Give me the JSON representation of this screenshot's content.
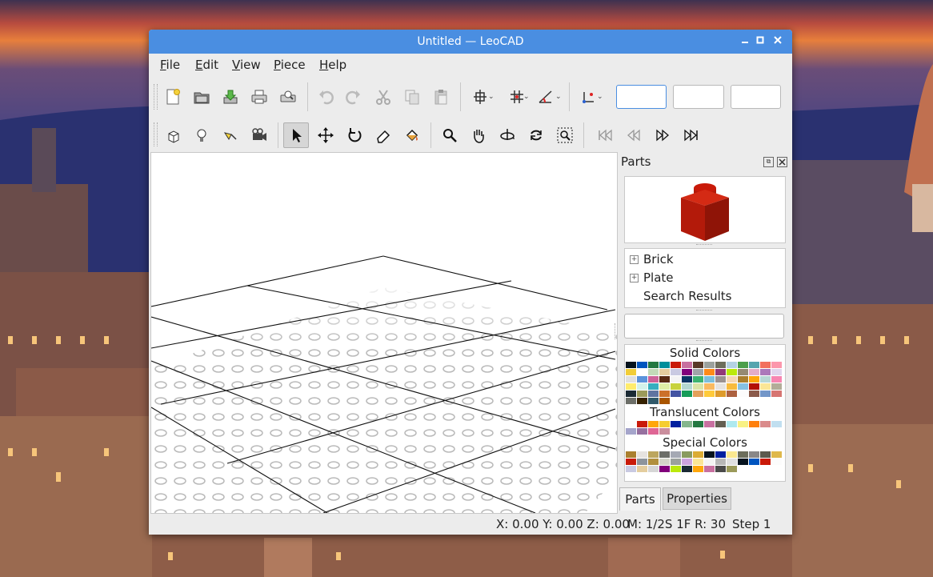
{
  "window": {
    "title": "Untitled — LeoCAD"
  },
  "menubar": {
    "items": [
      {
        "label": "File",
        "accel": "F",
        "rest": "ile"
      },
      {
        "label": "Edit",
        "accel": "E",
        "rest": "dit"
      },
      {
        "label": "View",
        "accel": "V",
        "rest": "iew"
      },
      {
        "label": "Piece",
        "accel": "P",
        "rest": "iece"
      },
      {
        "label": "Help",
        "accel": "H",
        "rest": "elp"
      }
    ]
  },
  "toolbar_top": {
    "icons": [
      "new-file-icon",
      "open-file-icon",
      "save-file-icon",
      "print-icon",
      "print-preview-icon",
      "undo-icon",
      "redo-icon",
      "cut-icon",
      "copy-icon",
      "paste-icon",
      "snap-move-icon",
      "snap-grid-icon",
      "snap-angle-icon",
      "transform-icon"
    ],
    "fields": [
      "",
      "",
      ""
    ]
  },
  "toolbar_tools": {
    "icons": [
      "insert-piece-icon",
      "light-icon",
      "spotlight-icon",
      "camera-icon",
      "select-arrow-icon",
      "move-icon",
      "rotate-icon",
      "eraser-icon",
      "paint-icon",
      "zoom-icon",
      "pan-hand-icon",
      "orbit-icon",
      "roll-icon",
      "zoom-region-icon",
      "first-step-icon",
      "previous-step-icon",
      "next-step-icon",
      "last-step-icon"
    ]
  },
  "parts": {
    "title": "Parts",
    "tree": [
      {
        "label": "Brick",
        "expandable": true
      },
      {
        "label": "Plate",
        "expandable": true
      },
      {
        "label": "Search Results",
        "expandable": false
      }
    ],
    "search_value": "",
    "preview_color": "#c91a09"
  },
  "colors": {
    "solid_label": "Solid Colors",
    "solid": [
      "#05131d",
      "#0055bf",
      "#237841",
      "#008f9b",
      "#c91a09",
      "#c870a0",
      "#583927",
      "#9ba19d",
      "#6d6e5c",
      "#b4d2e3",
      "#4b9f4a",
      "#55a5af",
      "#f2705e",
      "#fc97ac",
      "#f2cd37",
      "#fff",
      "#c2dab8",
      "#e4cd9e",
      "#c9cae2",
      "#81007b",
      "#a0a5a9",
      "#fe8a18",
      "#923978",
      "#bbe90b",
      "#958a73",
      "#e4adc8",
      "#ac78ba",
      "#e1d5ed",
      "#e0e0e0",
      "#5a93db",
      "#cd6298",
      "#582a12",
      "#f4f4f4",
      "#0a3463",
      "#3cb371",
      "#7dbfdd",
      "#9c9291",
      "#f6d7b3",
      "#aa7f2e",
      "#ffa70b",
      "#b7d7d5",
      "#f785b1",
      "#ffec6c",
      "#d3f2ea",
      "#36aebf",
      "#dfeea5",
      "#c7d23c",
      "#b3d7d1",
      "#d9e4a7",
      "#f9ba61",
      "#e6e3e0",
      "#f8bb3d",
      "#86c1e1",
      "#b31004",
      "#fbe696",
      "#b3ac98",
      "#1b2a34",
      "#9b9a5a",
      "#6074a1",
      "#cc702a",
      "#4354a3",
      "#169c59",
      "#e3a05b",
      "#ffca3a",
      "#de9b2b",
      "#ad6140",
      "#fcfcfc",
      "#8b5a4a",
      "#7396c8",
      "#d67572",
      "#6c6e68",
      "#352100",
      "#30596a",
      "#a95500"
    ],
    "translucent_label": "Translucent Colors",
    "translucent": [
      "#fcfcfc",
      "#c91a09",
      "#ffa70b",
      "#f5cd2f",
      "#0020a0",
      "#84b68d",
      "#237841",
      "#c870a0",
      "#635f52",
      "#aee9ef",
      "#f8f184",
      "#ff800d",
      "#da8b8b",
      "#c1dff0",
      "#a5a5cb",
      "#96709f",
      "#df6695",
      "#ca8e9d"
    ],
    "special_label": "Special Colors",
    "special": [
      "#aa7f2e",
      "#e6e3e0",
      "#bca65e",
      "#6c6e68",
      "#a5a9b4",
      "#899b5f",
      "#dbac34",
      "#05131d",
      "#0020a0",
      "#fbe890",
      "#6d6e5c",
      "#898788",
      "#5c5a4e",
      "#dfb84b",
      "#c91a09",
      "#8d949c",
      "#b18f3d",
      "#d4d5c9",
      "#9ba19d",
      "#cda4de",
      "#fbe696",
      "#f4f4f4",
      "#b7b7b7",
      "#e0e0e0",
      "#05131d",
      "#0055bf",
      "#c91a09",
      "#fcfcfc",
      "#c9cae2",
      "#e4cd9e",
      "#d6d6d6",
      "#81007b",
      "#bbe90b",
      "#1b2a34",
      "#ffa70b",
      "#c870a0",
      "#4a4a4a",
      "#9b9a5a"
    ]
  },
  "tabs": [
    {
      "label": "Parts",
      "active": true
    },
    {
      "label": "Properties",
      "active": false
    }
  ],
  "statusbar": {
    "coords": "X: 0.00 Y: 0.00 Z: 0.00",
    "snap": "M: 1/2S 1F R: 30",
    "step": "Step 1"
  }
}
